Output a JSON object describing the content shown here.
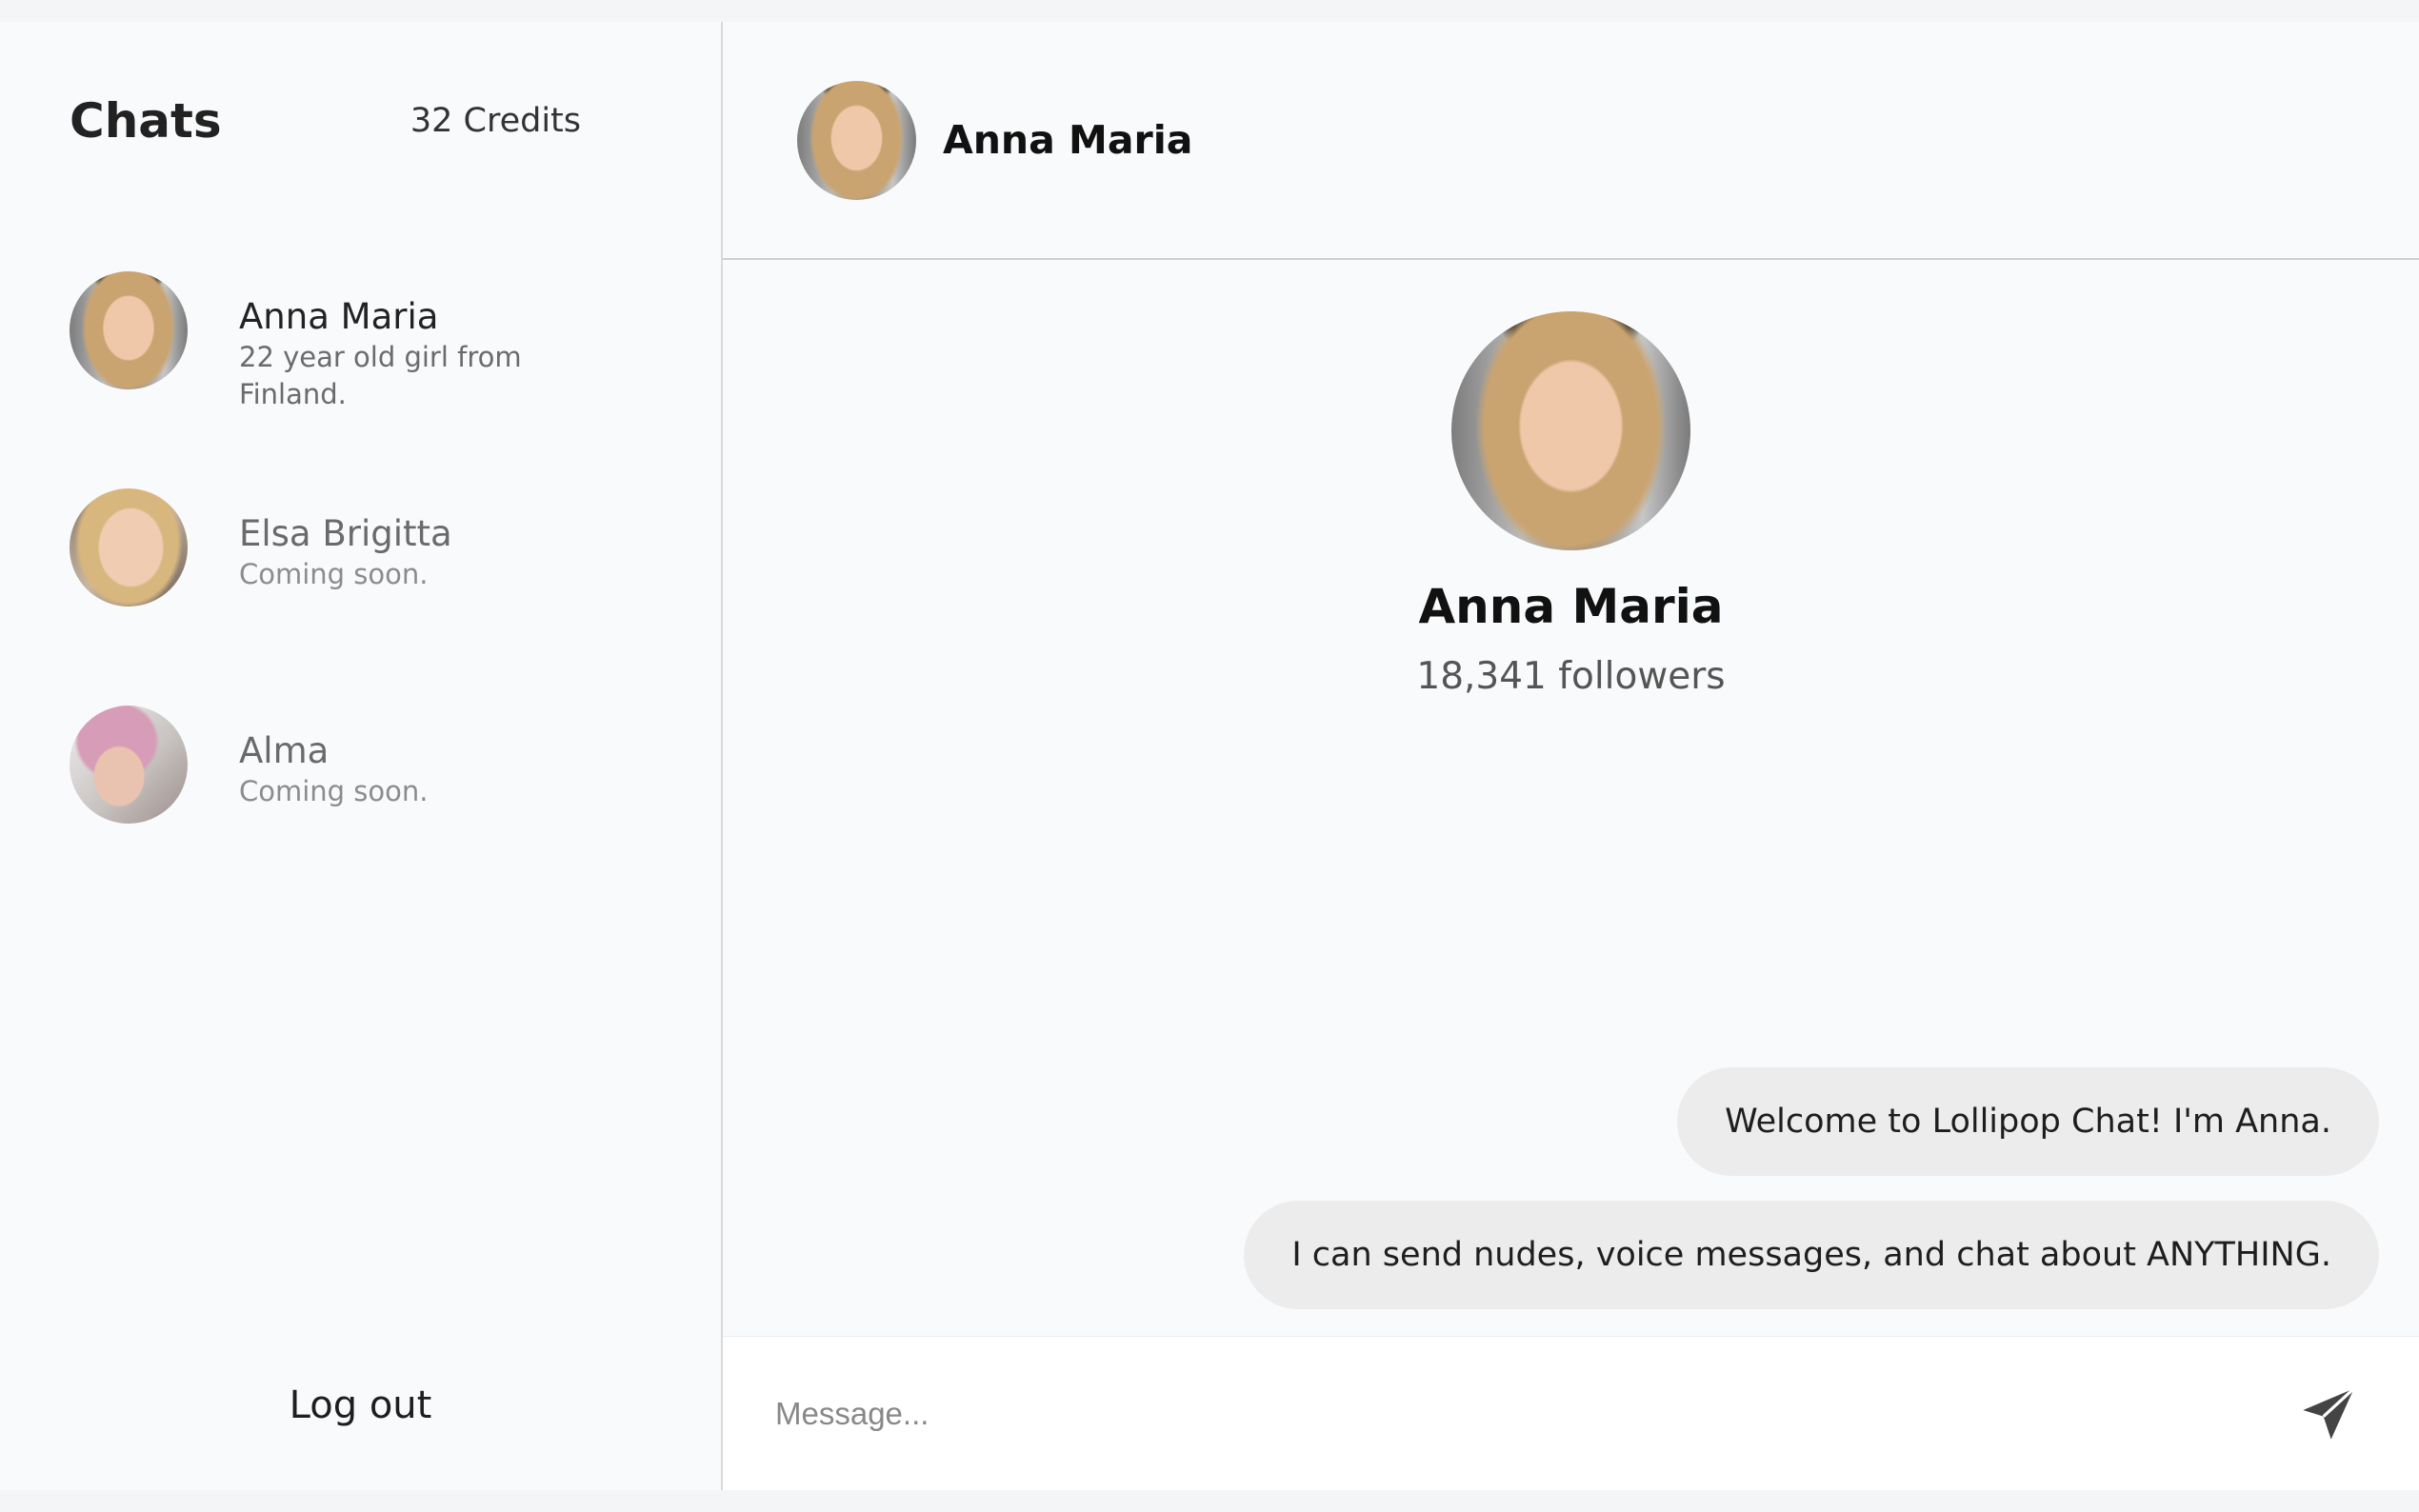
{
  "sidebar": {
    "title": "Chats",
    "credits": "32 Credits",
    "chats": [
      {
        "name": "Anna Maria",
        "description": "22 year old girl from Finland."
      },
      {
        "name": "Elsa Brigitta",
        "description": "Coming soon."
      },
      {
        "name": "Alma",
        "description": "Coming soon."
      }
    ],
    "logout_label": "Log out"
  },
  "header": {
    "name": "Anna Maria"
  },
  "profile": {
    "name": "Anna Maria",
    "followers": "18,341 followers"
  },
  "messages": [
    "Welcome to Lollipop Chat! I'm Anna.",
    "I can send nudes, voice messages, and chat about ANYTHING."
  ],
  "composer": {
    "placeholder": "Message...",
    "send_icon": "send-icon"
  }
}
